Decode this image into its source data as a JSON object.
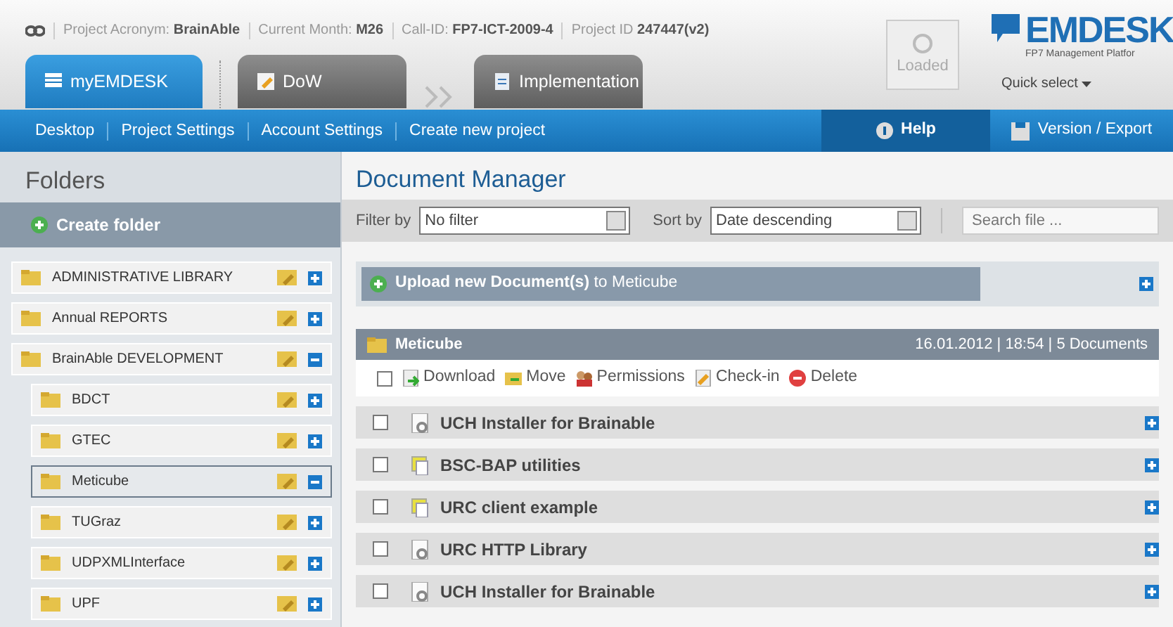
{
  "header": {
    "info": [
      "Project Acronym: **BrainAble**",
      "Current Month: **M26**",
      "Call-ID: **FP7-ICT-2009-4**",
      "Project ID **247447(v2)**"
    ],
    "tabs": [
      {
        "label": "myEMDESK",
        "selected": true,
        "kind": "list"
      },
      {
        "label": "DoW",
        "selected": false,
        "kind": "edit"
      },
      {
        "label": "Implementation",
        "selected": false,
        "kind": "doc"
      }
    ],
    "loaded": "Loaded",
    "logo": "EMDESK",
    "logo_tagline": "FP7 Management Platfor",
    "quick_select": "Quick select"
  },
  "nav": {
    "items": [
      "Desktop",
      "Project Settings",
      "Account Settings",
      "Create new project"
    ],
    "help": "Help",
    "version": "Version / Export"
  },
  "sidebar": {
    "title": "Folders",
    "create": "Create folder",
    "folders": [
      {
        "label": "ADMINISTRATIVE LIBRARY",
        "expanded": false,
        "selected": false
      },
      {
        "label": "Annual REPORTS",
        "expanded": false,
        "selected": false
      },
      {
        "label": "BrainAble DEVELOPMENT",
        "expanded": true,
        "selected": false,
        "children": [
          {
            "label": "BDCT",
            "expanded": false,
            "selected": false
          },
          {
            "label": "GTEC",
            "expanded": false,
            "selected": false
          },
          {
            "label": "Meticube",
            "expanded": true,
            "selected": true
          },
          {
            "label": "TUGraz",
            "expanded": false,
            "selected": false
          },
          {
            "label": "UDPXMLInterface",
            "expanded": false,
            "selected": false
          },
          {
            "label": "UPF",
            "expanded": false,
            "selected": false
          }
        ]
      }
    ]
  },
  "main": {
    "title": "Document Manager",
    "filter_label": "Filter by",
    "filter_value": "No filter",
    "sort_label": "Sort by",
    "sort_value": "Date descending",
    "search_placeholder": "Search file ...",
    "upload": "**Upload new Document(s)** to Meticube",
    "folder": {
      "name": "Meticube",
      "meta": "16.01.2012 | 18:54 | 5 Documents"
    },
    "select_all_checked": false,
    "actions": [
      {
        "label": "Download",
        "kind": "download"
      },
      {
        "label": "Move",
        "kind": "move"
      },
      {
        "label": "Permissions",
        "kind": "permissions"
      },
      {
        "label": "Check-in",
        "kind": "checkin"
      },
      {
        "label": "Delete",
        "kind": "delete"
      }
    ],
    "documents": [
      {
        "name": "UCH Installer for Brainable",
        "kind": "gear",
        "checked": false
      },
      {
        "name": "BSC-BAP utilities",
        "kind": "package",
        "checked": false
      },
      {
        "name": "URC client example",
        "kind": "package",
        "checked": false
      },
      {
        "name": "URC HTTP Library",
        "kind": "gear",
        "checked": false
      },
      {
        "name": "UCH Installer for Brainable",
        "kind": "gear",
        "checked": false
      }
    ]
  }
}
